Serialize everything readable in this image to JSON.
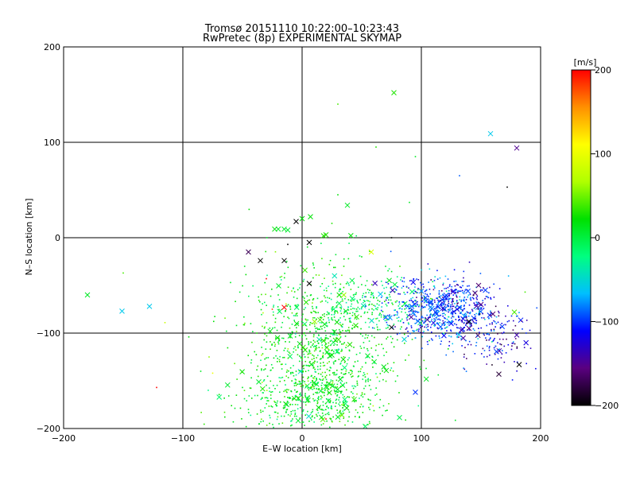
{
  "chart_data": {
    "type": "scatter",
    "title": "Tromsø 20151110 10:22:00–10:23:43",
    "subtitle": "RwPretec (8p) EXPERIMENTAL SKYMAP",
    "xlabel": "E–W location [km]",
    "ylabel": "N–S location [km]",
    "xlim": [
      -200,
      200
    ],
    "ylim": [
      -200,
      200
    ],
    "xticks": [
      -200,
      -100,
      0,
      100,
      200
    ],
    "yticks": [
      -200,
      -100,
      0,
      100,
      200
    ],
    "grid": true,
    "colorbar": {
      "label": "[m/s]",
      "range": [
        -200,
        200
      ],
      "ticks": [
        -200,
        -100,
        0,
        100,
        200
      ],
      "colormap": [
        "#000000",
        "#5a0080",
        "#0000ff",
        "#00bfff",
        "#00ff80",
        "#00e000",
        "#b0ff00",
        "#ffff00",
        "#ff9000",
        "#ff0000"
      ]
    },
    "series": [
      {
        "marker": "x",
        "points": [
          [
            77,
            152,
            30
          ],
          [
            158,
            109,
            -60
          ],
          [
            180,
            94,
            -150
          ],
          [
            -151,
            -77,
            -60
          ],
          [
            -128,
            -72,
            -60
          ],
          [
            -180,
            -60,
            10
          ],
          [
            -23,
            9,
            20
          ],
          [
            -20,
            9,
            10
          ],
          [
            -15,
            9,
            10
          ],
          [
            -12,
            8,
            5
          ],
          [
            -5,
            17,
            -200
          ],
          [
            0,
            20,
            20
          ],
          [
            7,
            22,
            20
          ],
          [
            18,
            2,
            30
          ],
          [
            20,
            3,
            30
          ],
          [
            38,
            34,
            10
          ],
          [
            58,
            -15,
            90
          ],
          [
            -45,
            -15,
            -170
          ],
          [
            -35,
            -24,
            -200
          ],
          [
            -15,
            -24,
            -200
          ],
          [
            6,
            -5,
            -200
          ],
          [
            6,
            -48,
            -200
          ],
          [
            -15,
            -73,
            200
          ],
          [
            -10,
            -103,
            10
          ],
          [
            15,
            -86,
            40
          ],
          [
            18,
            -108,
            30
          ],
          [
            25,
            -123,
            20
          ],
          [
            22,
            -171,
            10
          ],
          [
            40,
            -112,
            30
          ],
          [
            45,
            -92,
            30
          ],
          [
            35,
            -60,
            60
          ],
          [
            10,
            -152,
            10
          ],
          [
            30,
            -188,
            10
          ],
          [
            75,
            -94,
            -200
          ],
          [
            95,
            -162,
            -100
          ],
          [
            100,
            -56,
            -80
          ],
          [
            108,
            -67,
            -90
          ],
          [
            112,
            -78,
            -100
          ],
          [
            120,
            -62,
            -100
          ],
          [
            125,
            -90,
            -110
          ],
          [
            130,
            -75,
            -120
          ],
          [
            135,
            -85,
            -120
          ],
          [
            140,
            -95,
            -150
          ],
          [
            148,
            -50,
            -160
          ],
          [
            150,
            -70,
            -150
          ],
          [
            160,
            -80,
            -160
          ],
          [
            178,
            -78,
            40
          ],
          [
            182,
            -133,
            -200
          ],
          [
            165,
            -143,
            -180
          ],
          [
            140,
            -88,
            -200
          ],
          [
            105,
            -86,
            -150
          ],
          [
            118,
            -74,
            -130
          ],
          [
            127,
            -56,
            -110
          ],
          [
            92,
            -72,
            -90
          ],
          [
            145,
            -58,
            -160
          ]
        ]
      },
      {
        "marker": "dot",
        "points": [
          [
            -150,
            -37,
            40
          ],
          [
            -122,
            -157,
            200
          ],
          [
            -115,
            -89,
            80
          ],
          [
            -78,
            -125,
            60
          ],
          [
            -75,
            -142,
            100
          ],
          [
            -95,
            -104,
            20
          ],
          [
            -60,
            -47,
            10
          ],
          [
            -55,
            -92,
            10
          ],
          [
            -30,
            -43,
            200
          ],
          [
            -25,
            -75,
            180
          ],
          [
            -45,
            -180,
            10
          ],
          [
            -30,
            -126,
            10
          ],
          [
            -20,
            -60,
            10
          ],
          [
            30,
            140,
            40
          ],
          [
            30,
            45,
            20
          ],
          [
            62,
            95,
            30
          ],
          [
            90,
            37,
            10
          ],
          [
            95,
            85,
            10
          ],
          [
            172,
            53,
            -200
          ],
          [
            132,
            65,
            -90
          ],
          [
            70,
            -30,
            10
          ],
          [
            82,
            -30,
            40
          ],
          [
            -12,
            -7,
            -200
          ],
          [
            25,
            15,
            30
          ],
          [
            50,
            -20,
            20
          ],
          [
            75,
            0,
            -200
          ],
          [
            187,
            -57,
            40
          ],
          [
            20,
            -190,
            200
          ],
          [
            35,
            -30,
            30
          ],
          [
            -5,
            -140,
            10
          ],
          [
            -8,
            -190,
            10
          ],
          [
            -38,
            -100,
            30
          ],
          [
            -50,
            -157,
            10
          ],
          [
            -85,
            -140,
            10
          ],
          [
            -65,
            -183,
            40
          ]
        ]
      }
    ],
    "clusters": [
      {
        "center_x": 15,
        "center_y": -120,
        "spread_x": 30,
        "spread_y": 42,
        "count": 900,
        "value_mean": 15,
        "value_spread": 40
      },
      {
        "center_x": 0,
        "center_y": -175,
        "spread_x": 30,
        "spread_y": 18,
        "count": 280,
        "value_mean": 10,
        "value_spread": 40
      },
      {
        "center_x": 60,
        "center_y": -72,
        "spread_x": 28,
        "spread_y": 14,
        "count": 230,
        "value_mean": -5,
        "value_spread": 45
      },
      {
        "center_x": 118,
        "center_y": -75,
        "spread_x": 22,
        "spread_y": 17,
        "count": 620,
        "value_mean": -100,
        "value_spread": 55
      },
      {
        "center_x": 160,
        "center_y": -100,
        "spread_x": 15,
        "spread_y": 22,
        "count": 120,
        "value_mean": -130,
        "value_spread": 60
      }
    ]
  }
}
